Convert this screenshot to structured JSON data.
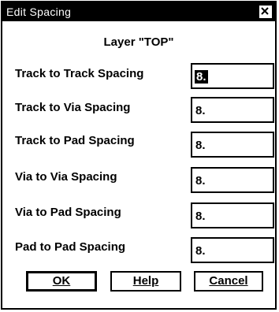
{
  "dialog": {
    "title": "Edit Spacing",
    "layer_label": "Layer \"TOP\""
  },
  "rows": [
    {
      "label": "Track to Track Spacing",
      "value": "8."
    },
    {
      "label": "Track to Via Spacing",
      "value": "8."
    },
    {
      "label": "Track to Pad Spacing",
      "value": "8."
    },
    {
      "label": "Via to Via Spacing",
      "value": "8."
    },
    {
      "label": "Via to Pad Spacing",
      "value": "8."
    },
    {
      "label": "Pad to Pad Spacing",
      "value": "8."
    }
  ],
  "buttons": {
    "ok": "OK",
    "help": "Help",
    "cancel": "Cancel"
  },
  "icons": {
    "close": "close-icon"
  }
}
